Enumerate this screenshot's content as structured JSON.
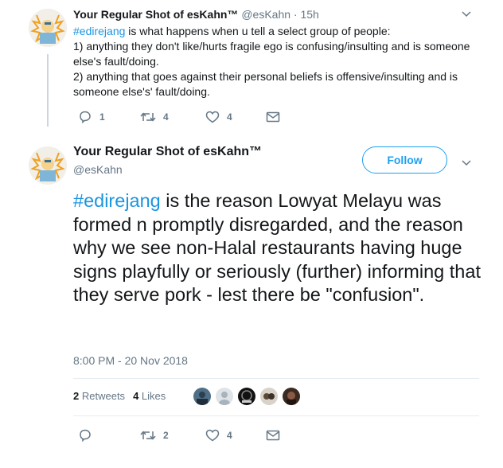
{
  "tweet1": {
    "name": "Your Regular Shot of esKahn™",
    "handle": "@esKahn",
    "time": "· 15h",
    "hashtag": "#edirejang",
    "text_after_hashtag": " is what happens when u tell a select group of people:",
    "line1": "1) anything they don't like/hurts fragile ego is confusing/insulting and is someone else's fault/doing.",
    "line2": "2) anything that goes against their personal beliefs is offensive/insulting and is someone else's' fault/doing.",
    "reply_count": "1",
    "retweet_count": "4",
    "like_count": "4"
  },
  "tweet2": {
    "name": "Your Regular Shot of esKahn™",
    "handle": "@esKahn",
    "follow_label": "Follow",
    "hashtag": "#edirejang",
    "text_after_hashtag": " is the reason Lowyat Melayu was formed n promptly disregarded, and the reason why we see non-Halal restaurants having huge signs playfully or seriously (further) informing that they serve pork - lest there be \"confusion\".",
    "timestamp": "8:00 PM - 20 Nov 2018",
    "retweets_count": "2",
    "retweets_label": "Retweets",
    "likes_count": "4",
    "likes_label": "Likes",
    "retweet_count": "2",
    "like_count": "4"
  },
  "colors": {
    "link": "#1b95e0",
    "muted": "#657786",
    "follow": "#1da1f2",
    "divider": "#e6ecf0"
  },
  "icons": [
    "avatar-icon",
    "reply-icon",
    "retweet-icon",
    "like-icon",
    "message-icon",
    "chevron-down-icon"
  ]
}
